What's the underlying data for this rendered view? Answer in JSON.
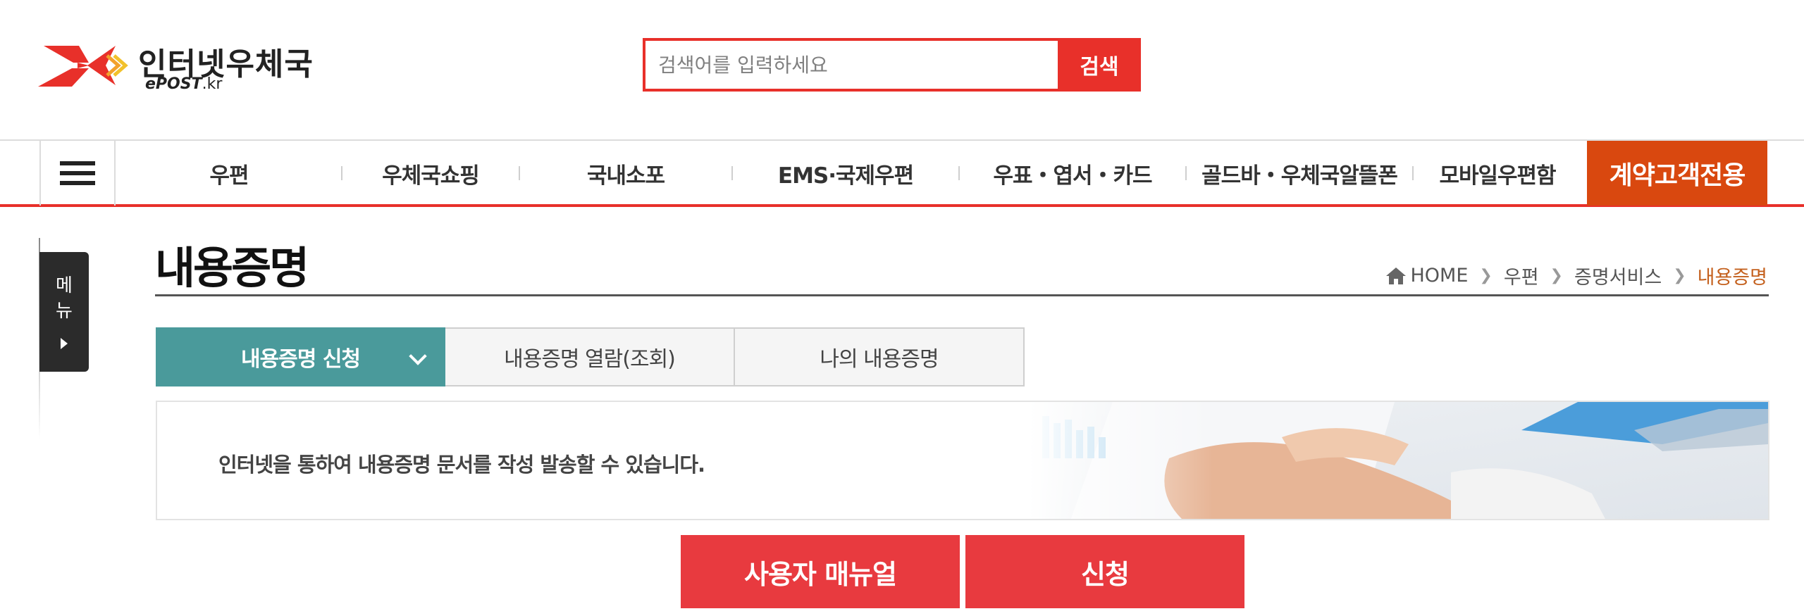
{
  "logo": {
    "title": "인터넷우체국",
    "sub_brand": "ePOST",
    "sub_domain": ".kr"
  },
  "search": {
    "placeholder": "검색어를 입력하세요",
    "button_label": "검색"
  },
  "gnb": {
    "items": [
      "우편",
      "우체국쇼핑",
      "국내소포",
      "EMS·국제우편",
      "우표・엽서・카드",
      "골드바・우체국알뜰폰",
      "모바일우편함"
    ],
    "special": "계약고객전용"
  },
  "side_menu": {
    "label": "메뉴"
  },
  "page": {
    "title": "내용증명"
  },
  "breadcrumb": [
    "HOME",
    "우편",
    "증명서비스",
    "내용증명"
  ],
  "tabs": [
    {
      "label": "내용증명 신청",
      "active": true
    },
    {
      "label": "내용증명 열람(조회)",
      "active": false
    },
    {
      "label": "나의 내용증명",
      "active": false
    }
  ],
  "banner": {
    "text": "인터넷을 통하여 내용증명 문서를 작성 발송할 수 있습니다."
  },
  "actions": {
    "manual": "사용자 매뉴얼",
    "apply": "신청"
  },
  "colors": {
    "brand_red": "#e8302a",
    "special_orange": "#d9480f",
    "tab_teal": "#4a9a9b",
    "breadcrumb_current": "#c4601d",
    "button_red": "#e83a3f"
  }
}
